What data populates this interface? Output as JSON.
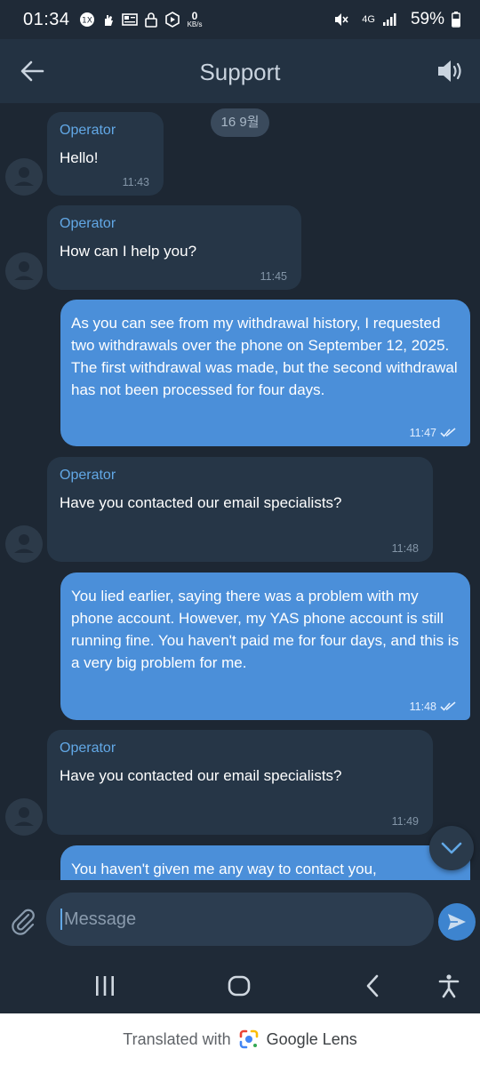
{
  "status_bar": {
    "time": "01:34",
    "net_speed_value": "0",
    "net_speed_unit": "KB/s",
    "network": "4G",
    "battery": "59%"
  },
  "header": {
    "title": "Support",
    "back_icon": "arrow-left-icon",
    "sound_icon": "speaker-icon"
  },
  "chat": {
    "date_chip": "16 9월",
    "messages": [
      {
        "direction": "in",
        "sender": "Operator",
        "text": "Hello!",
        "time": "11:43"
      },
      {
        "direction": "in",
        "sender": "Operator",
        "text": "How can I help you?",
        "time": "11:45"
      },
      {
        "direction": "out",
        "text": "As you can see from my withdrawal history, I requested two withdrawals over the phone on September 12, 2025. The first withdrawal was made, but the second withdrawal has not been processed for four days.",
        "time": "11:47"
      },
      {
        "direction": "in",
        "sender": "Operator",
        "text": "Have you contacted our email specialists?",
        "time": "11:48"
      },
      {
        "direction": "out",
        "text": "You lied earlier, saying there was a problem with my phone account. However, my YAS phone account is still running fine. You haven't paid me for four days, and this is a very big problem for me.",
        "time": "11:48"
      },
      {
        "direction": "in",
        "sender": "Operator",
        "text": "Have you contacted our email specialists?",
        "time": "11:49"
      },
      {
        "direction": "out",
        "text": "You haven't given me any way to contact you,",
        "time": ""
      }
    ]
  },
  "input": {
    "placeholder": "Message"
  },
  "footer": {
    "prefix": "Translated with",
    "brand": "Google Lens"
  },
  "colors": {
    "background": "#1d2733",
    "incoming_bubble": "#263647",
    "outgoing_bubble": "#4b8fd9",
    "sender_name": "#62a8e6"
  }
}
